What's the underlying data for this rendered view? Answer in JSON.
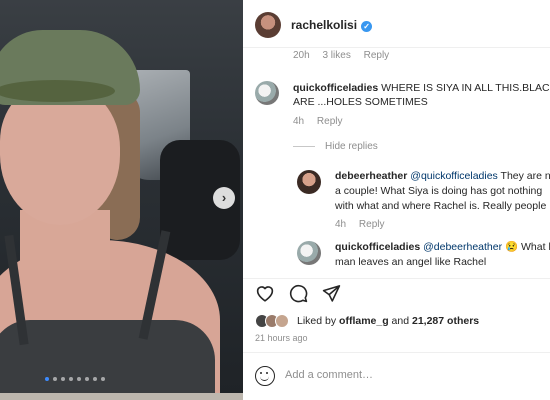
{
  "post": {
    "username": "rachelkolisi",
    "verified": true
  },
  "previous_comment_meta": {
    "time": "20h",
    "likes": "3 likes",
    "reply": "Reply"
  },
  "comments": [
    {
      "username": "quickofficeladies",
      "line1": "WHERE IS SIYA IN ALL THIS.BLACK FA",
      "line2": "ARE ...HOLES SOMETIMES",
      "time": "4h",
      "reply": "Reply"
    }
  ],
  "hide_replies_label": "Hide replies",
  "replies": [
    {
      "username": "debeerheather",
      "mention": "@quickofficeladies",
      "line1_rest": "They are n",
      "line2": "a couple! What Siya is doing has got nothing",
      "line3": "with what and where Rachel is. Really people",
      "time": "4h",
      "reply": "Reply"
    },
    {
      "username": "quickofficeladies",
      "mention": "@debeerheather",
      "emoji": "😢",
      "line1_rest": "What k",
      "line2": "man leaves an angel like Rachel"
    }
  ],
  "likes": {
    "prefix": "Liked by",
    "user": "offlame_g",
    "middle": "and",
    "count": "21,287 others"
  },
  "posted_time": "21 hours ago",
  "add_comment_placeholder": "Add a comment…",
  "carousel": {
    "slides": 8,
    "active_index": 0
  },
  "colors": {
    "verified": "#3897f0",
    "mention": "#00376b",
    "muted": "#8e8e8e",
    "active_dot": "#3d8bfd"
  }
}
